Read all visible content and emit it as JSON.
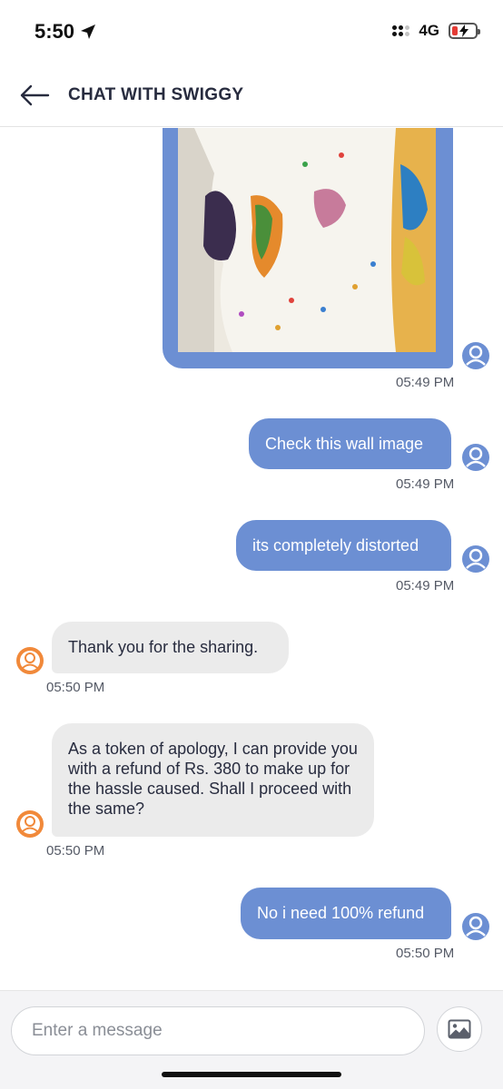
{
  "status_bar": {
    "time": "5:50",
    "network": "4G",
    "battery_color": "#e43b35"
  },
  "header": {
    "title": "CHAT WITH SWIGGY",
    "back_icon": "arrow-left-icon"
  },
  "messages": [
    {
      "from": "user",
      "type": "image",
      "time": "05:49 PM"
    },
    {
      "from": "user",
      "type": "text",
      "text": "Check this wall image",
      "time": "05:49 PM"
    },
    {
      "from": "user",
      "type": "text",
      "text": "its completely distorted",
      "time": "05:49 PM"
    },
    {
      "from": "agent",
      "type": "text",
      "text": "Thank you for the sharing.",
      "time": "05:50 PM"
    },
    {
      "from": "agent",
      "type": "text",
      "text": "As a token of apology, I can provide you with a refund of Rs. 380 to make up for the hassle caused. Shall I proceed with the same?",
      "time": "05:50 PM"
    },
    {
      "from": "user",
      "type": "text",
      "text": "No i need 100% refund",
      "time": "05:50 PM"
    }
  ],
  "composer": {
    "placeholder": "Enter a message",
    "attach_icon": "image-icon"
  },
  "colors": {
    "outgoing_bubble": "#6c8fd3",
    "incoming_bubble": "#ebebeb",
    "agent_avatar": "#f1893a"
  }
}
